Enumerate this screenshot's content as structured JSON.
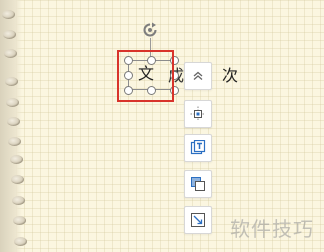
{
  "slide": {
    "selected_text": "文",
    "partial_text": "成",
    "trailing_text": "次"
  },
  "float_toolbar": {
    "buttons": [
      {
        "name": "collapse-icon"
      },
      {
        "name": "align-center-icon"
      },
      {
        "name": "text-wrap-icon"
      },
      {
        "name": "layer-order-icon"
      },
      {
        "name": "crop-resize-icon"
      }
    ]
  },
  "watermark": {
    "text": "软件技巧"
  },
  "colors": {
    "highlight": "#d8332b",
    "toolbar_icon": "#2b6fc2",
    "paper": "#fbf6e0"
  }
}
